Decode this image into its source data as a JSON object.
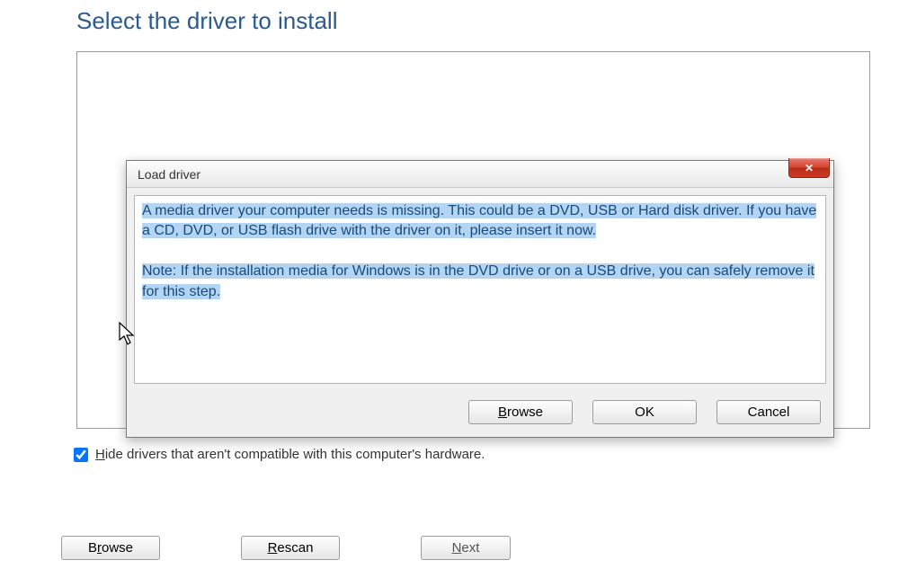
{
  "main": {
    "title": "Select the driver to install",
    "hide_checkbox_checked": true,
    "hide_label_prefix": "H",
    "hide_label_rest": "ide drivers that aren't compatible with this computer's hardware.",
    "browse_prefix": "B",
    "browse_underlined": "r",
    "browse_rest": "owse",
    "rescan_prefix": "",
    "rescan_underlined": "R",
    "rescan_rest": "escan",
    "next_prefix": "",
    "next_underlined": "N",
    "next_rest": "ext"
  },
  "dialog": {
    "title": "Load driver",
    "paragraph1": "A media driver your computer needs is missing. This could be a DVD, USB or Hard disk driver. If you have a CD, DVD, or USB flash drive with the driver on it, please insert it now.",
    "paragraph2": "Note: If the installation media for Windows is in the DVD drive or on a USB drive, you can safely remove it for this step.",
    "browse_prefix": "",
    "browse_underlined": "B",
    "browse_rest": "rowse",
    "ok_label": "OK",
    "cancel_label": "Cancel"
  }
}
